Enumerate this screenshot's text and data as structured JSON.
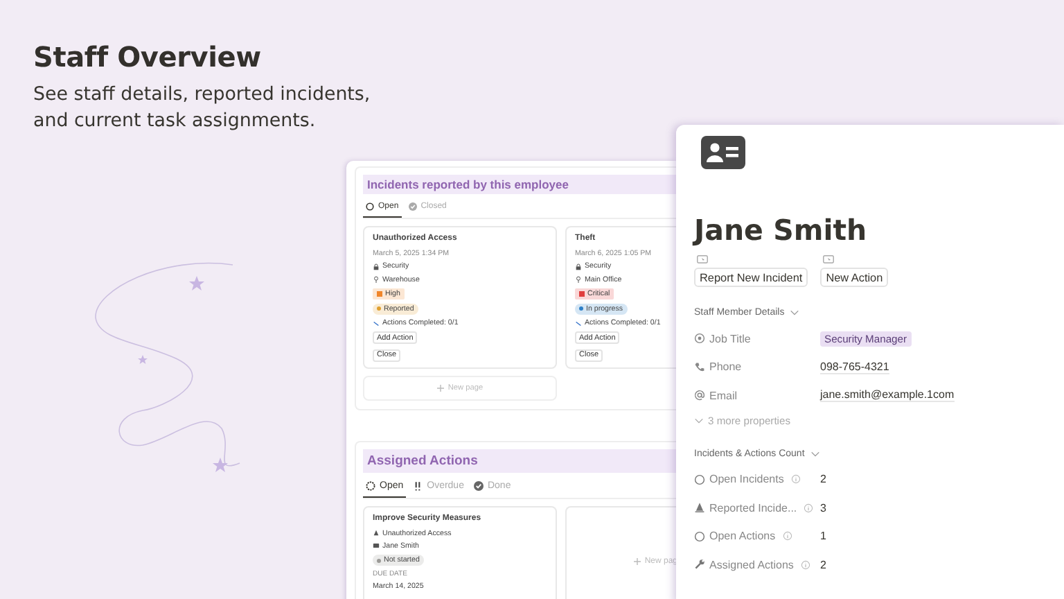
{
  "header": {
    "title": "Staff Overview",
    "subtitle": "See staff details, reported incidents, and current task assignments."
  },
  "incidents": {
    "title": "Incidents reported by this employee",
    "tabs": [
      {
        "label": "Open",
        "selected": true
      },
      {
        "label": "Closed",
        "selected": false
      }
    ],
    "cards": [
      {
        "title": "Unauthorized Access",
        "date": "March 5, 2025 1:34 PM",
        "category": "Security",
        "location": "Warehouse",
        "priority": {
          "label": "High",
          "color": "#f0862a"
        },
        "status": {
          "label": "Reported",
          "color": "#e0a030"
        },
        "progress": "Actions Completed: 0/1",
        "buttons": [
          "Add Action",
          "Close"
        ]
      },
      {
        "title": "Theft",
        "date": "March 6, 2025 1:05 PM",
        "category": "Security",
        "location": "Main Office",
        "priority": {
          "label": "Critical",
          "color": "#e03e3e"
        },
        "status": {
          "label": "In progress",
          "color": "#2f80c8"
        },
        "progress": "Actions Completed: 0/1",
        "buttons": [
          "Add Action",
          "Close"
        ]
      }
    ],
    "new_page": "New page"
  },
  "actions": {
    "title": "Assigned Actions",
    "tabs": [
      {
        "label": "Open",
        "selected": true
      },
      {
        "label": "Overdue",
        "selected": false
      },
      {
        "label": "Done",
        "selected": false
      }
    ],
    "cards": [
      {
        "title": "Improve Security Measures",
        "incident": "Unauthorized Access",
        "assignee": "Jane Smith",
        "status": {
          "label": "Not started",
          "color": "#9b9a97"
        },
        "due_label": "DUE DATE",
        "due_date": "March 14, 2025"
      }
    ],
    "new_page": "New pag"
  },
  "profile": {
    "name": "Jane Smith",
    "buttons": [
      "Report New Incident",
      "New Action"
    ],
    "details_heading": "Staff Member Details",
    "details": [
      {
        "label": "Job Title",
        "value": "Security Manager",
        "kind": "tag"
      },
      {
        "label": "Phone",
        "value": "098-765-4321",
        "kind": "text"
      },
      {
        "label": "Email",
        "value": "jane.smith@example.1com",
        "kind": "text"
      }
    ],
    "more": "3 more properties",
    "counts_heading": "Incidents & Actions Count",
    "counts": [
      {
        "label": "Open Incidents",
        "value": "2"
      },
      {
        "label": "Reported Incide...",
        "value": "3"
      },
      {
        "label": "Open Actions",
        "value": "1"
      },
      {
        "label": "Assigned Actions",
        "value": "2"
      }
    ]
  }
}
